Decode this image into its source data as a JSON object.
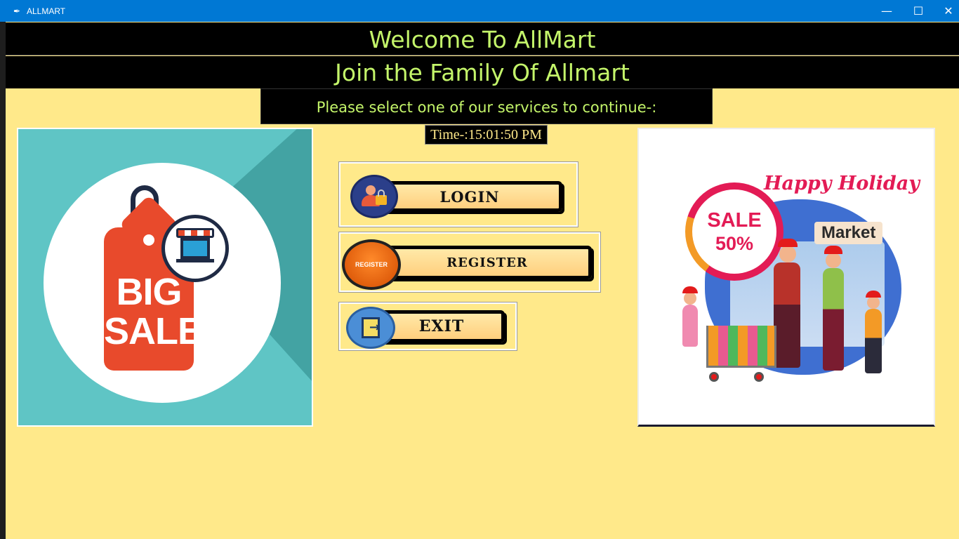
{
  "window": {
    "title": "ALLMART",
    "app_icon": "feather-icon",
    "controls": {
      "minimize": "—",
      "maximize": "☐",
      "close": "✕"
    }
  },
  "header": {
    "welcome": "Welcome To AllMart",
    "join": "Join the Family Of Allmart",
    "prompt": "Please select one of our services to continue-:"
  },
  "clock": {
    "text": "Time-:15:01:50 PM"
  },
  "buttons": {
    "login": {
      "label": "LOGIN",
      "icon": "user-lock-icon"
    },
    "register": {
      "label": "REGISTER",
      "icon": "register-icon",
      "icon_text": "REGISTER"
    },
    "exit": {
      "label": "EXIT",
      "icon": "exit-door-icon"
    }
  },
  "left_image": {
    "tag_text": "BIG SALE",
    "line1": "BIG",
    "line2": "SALE"
  },
  "right_image": {
    "heading": "Happy Holiday",
    "sale_line1": "SALE",
    "sale_line2": "50%",
    "market": "Market"
  },
  "colors": {
    "background": "#ffe98a",
    "banner_bg": "#000000",
    "banner_text": "#c4f56a",
    "titlebar": "#0078d4",
    "sale_red": "#e31b55"
  }
}
